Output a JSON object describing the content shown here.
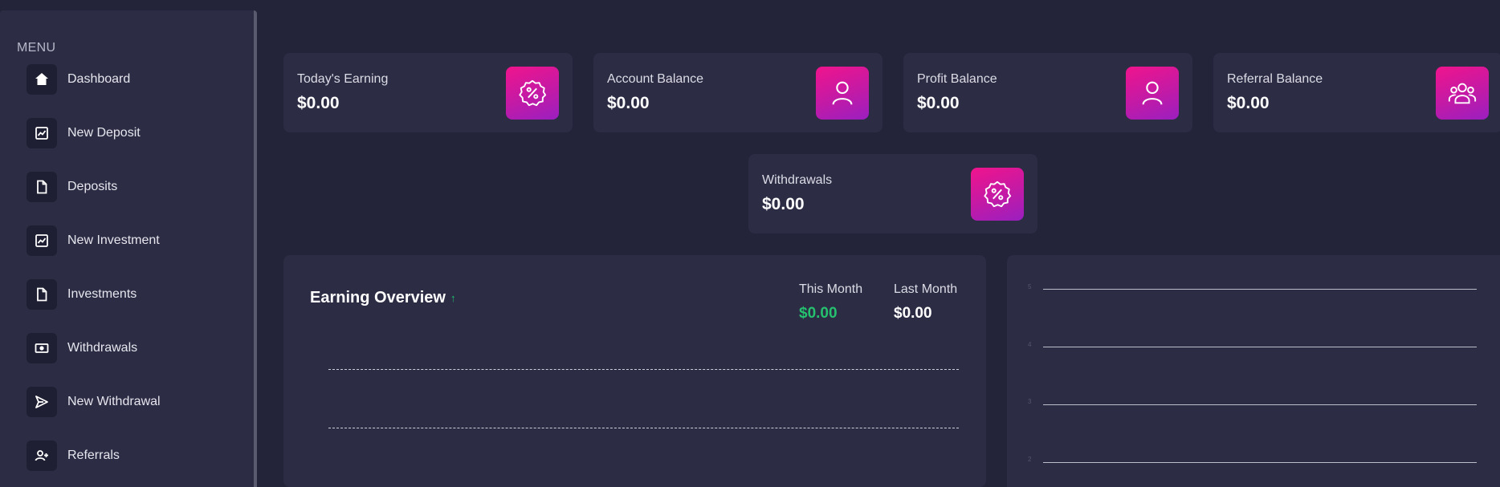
{
  "sidebar": {
    "heading": "MENU",
    "items": [
      {
        "label": "Dashboard",
        "icon": "home-icon"
      },
      {
        "label": "New Deposit",
        "icon": "chart-line-icon"
      },
      {
        "label": "Deposits",
        "icon": "file-icon"
      },
      {
        "label": "New Investment",
        "icon": "chart-line-icon"
      },
      {
        "label": "Investments",
        "icon": "file-icon"
      },
      {
        "label": "Withdrawals",
        "icon": "money-icon"
      },
      {
        "label": "New Withdrawal",
        "icon": "send-icon"
      },
      {
        "label": "Referrals",
        "icon": "user-plus-icon"
      }
    ]
  },
  "cards": [
    {
      "label": "Today's Earning",
      "value": "$0.00",
      "icon": "badge-percent-icon"
    },
    {
      "label": "Account Balance",
      "value": "$0.00",
      "icon": "user-icon"
    },
    {
      "label": "Profit Balance",
      "value": "$0.00",
      "icon": "user-icon"
    },
    {
      "label": "Referral Balance",
      "value": "$0.00",
      "icon": "users-icon"
    },
    {
      "label": "Withdrawals",
      "value": "$0.00",
      "icon": "badge-percent-icon"
    }
  ],
  "earning_overview": {
    "title": "Earning Overview",
    "arrow": "↑",
    "this_month_label": "This Month",
    "this_month_value": "$0.00",
    "last_month_label": "Last Month",
    "last_month_value": "$0.00",
    "y_ticks": [
      "",
      "",
      ""
    ]
  },
  "right_chart": {
    "y_ticks": [
      "5",
      "4",
      "3",
      "2"
    ]
  },
  "colors": {
    "background": "#23233a",
    "panel": "#2c2c45",
    "accent_gradient_start": "#f0148c",
    "accent_gradient_end": "#9a1fc0",
    "positive": "#25c16f"
  }
}
